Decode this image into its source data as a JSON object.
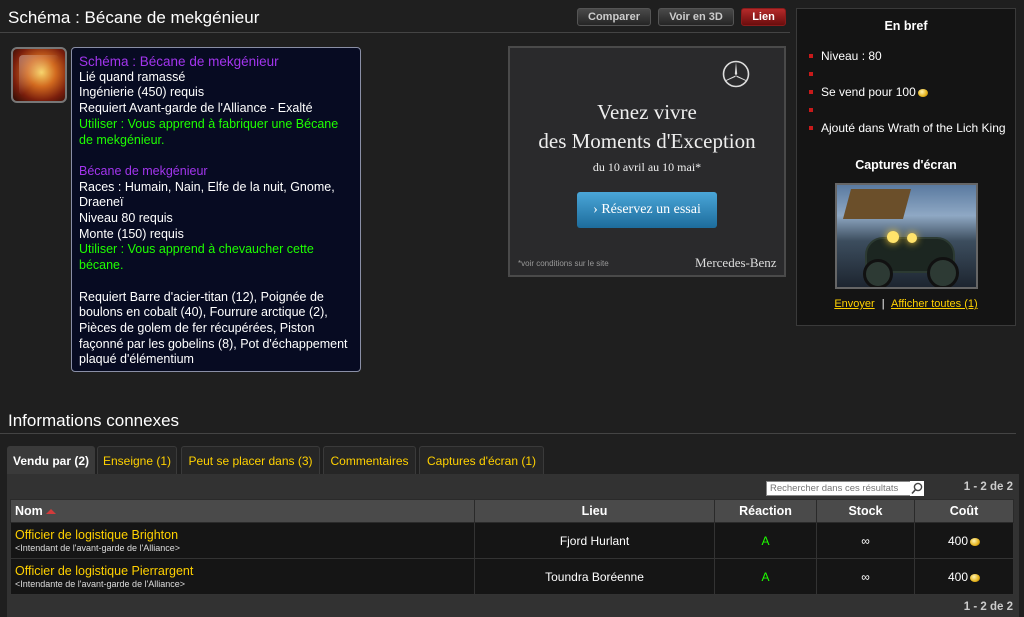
{
  "header": {
    "title": "Schéma : Bécane de mekgénieur",
    "buttons": {
      "compare": "Comparer",
      "view3d": "Voir en 3D",
      "link": "Lien"
    }
  },
  "tooltip": {
    "name": "Schéma : Bécane de mekgénieur",
    "bind": "Lié quand ramassé",
    "skill": "Ingénierie (450) requis",
    "rep": "Requiert Avant-garde de l'Alliance - Exalté",
    "use1_l1": "Utiliser : Vous apprend à fabriquer une Bécane",
    "use1_l2": "de mekgénieur.",
    "item_name": "Bécane de mekgénieur",
    "races_l1": "Races : Humain, Nain, Elfe de la nuit, Gnome,",
    "races_l2": "Draeneï",
    "level": "Niveau 80 requis",
    "riding": "Monte (150) requis",
    "use2_l1": "Utiliser : Vous apprend à chevaucher cette",
    "use2_l2": "bécane.",
    "reagents_l1": "Requiert Barre d'acier-titan (12), Poignée de",
    "reagents_l2": "boulons en cobalt (40), Fourrure arctique (2),",
    "reagents_l3": "Pièces de golem de fer récupérées, Piston",
    "reagents_l4": "façonné par les gobelins (8), Pot d'échappement",
    "reagents_l5": "plaqué d'élémentium"
  },
  "ad": {
    "headline1": "Venez vivre",
    "headline2": "des Moments d'Exception",
    "dates": "du 10 avril au 10 mai*",
    "cta": "› Réservez un essai",
    "fineprint": "*voir conditions sur le site",
    "brand": "Mercedes-Benz"
  },
  "sidebar": {
    "title": "En bref",
    "items": {
      "level": "Niveau : 80",
      "empty1": "",
      "sells": "Se vend pour 100",
      "empty2": "",
      "added": "Ajouté dans Wrath of the Lich King"
    },
    "screens_title": "Captures d'écran",
    "link_send": "Envoyer",
    "link_sep": "|",
    "link_all": "Afficher toutes (1)"
  },
  "related": {
    "title": "Informations connexes",
    "tabs": [
      {
        "label": "Vendu par (2)"
      },
      {
        "label": "Enseigne (1)"
      },
      {
        "label": "Peut se placer dans (3)"
      },
      {
        "label": "Commentaires"
      },
      {
        "label": "Captures d'écran (1)"
      }
    ],
    "search_placeholder": "Rechercher dans ces résultats",
    "pager": "1 - 2 de 2",
    "columns": {
      "name": "Nom",
      "location": "Lieu",
      "reaction": "Réaction",
      "stock": "Stock",
      "cost": "Coût"
    },
    "rows": [
      {
        "name": "Officier de logistique Brighton",
        "subtitle": "<Intendant de l'avant-garde de l'Alliance>",
        "location": "Fjord Hurlant",
        "reaction": "A",
        "stock": "∞",
        "cost": "400"
      },
      {
        "name": "Officier de logistique Pierrargent",
        "subtitle": "<Intendante de l'avant-garde de l'Alliance>",
        "location": "Toundra Boréenne",
        "reaction": "A",
        "stock": "∞",
        "cost": "400"
      }
    ]
  },
  "colors": {
    "epic": "#a335ee",
    "use": "#1eff00",
    "link": "#ffd100",
    "bullet": "#c81a1a"
  }
}
